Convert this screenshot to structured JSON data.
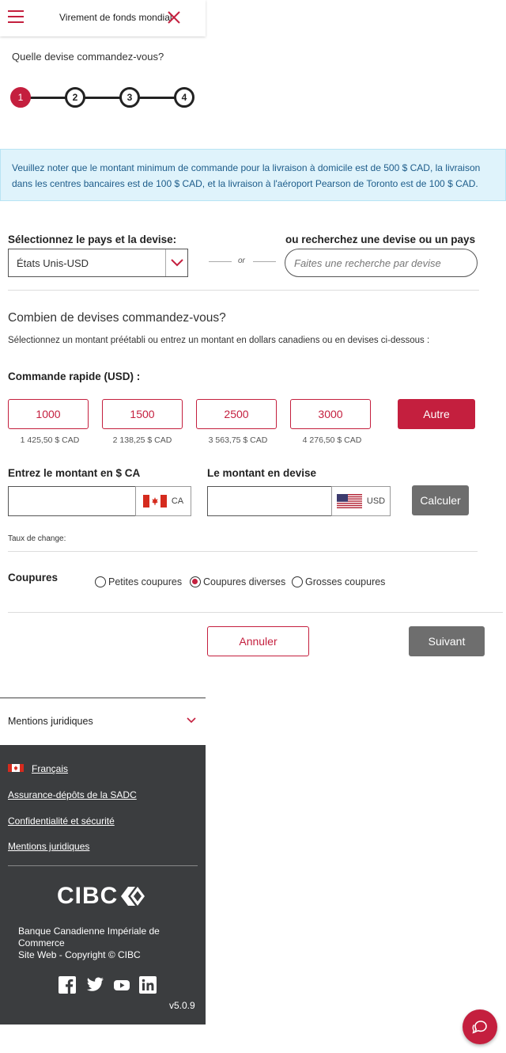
{
  "header": {
    "title": "Virement de fonds mondial"
  },
  "question": "Quelle devise commandez-vous?",
  "stepper": {
    "steps": [
      "1",
      "2",
      "3",
      "4"
    ],
    "current_step": 1
  },
  "notice": "Veuillez noter que le montant minimum de commande pour la livraison à domicile est de 500 $ CAD, la livraison dans les centres bancaires est de 100 $ CAD, et la livraison à l'aéroport Pearson de Toronto est de 100 $ CAD.",
  "country_select": {
    "label": "Sélectionnez le pays et la devise:",
    "value": "États Unis-USD"
  },
  "or_text": "or",
  "search": {
    "label": "ou recherchez une devise ou un pays",
    "placeholder": "Faites une recherche par devise",
    "value": ""
  },
  "amount_section": {
    "title": "Combien de devises commandez-vous?",
    "subtitle": "Sélectionnez un montant préétabli ou entrez un montant en dollars canadiens ou en devises ci-dessous :"
  },
  "quick_order": {
    "label": "Commande rapide (USD) :",
    "options": [
      {
        "amount": "1000",
        "cad": "1 425,50 $ CAD"
      },
      {
        "amount": "1500",
        "cad": "2 138,25 $ CAD"
      },
      {
        "amount": "2500",
        "cad": "3 563,75 $ CAD"
      },
      {
        "amount": "3000",
        "cad": "4 276,50 $ CAD"
      }
    ],
    "other_label": "Autre"
  },
  "cad_input": {
    "label": "Entrez le montant en $ CA",
    "value": "",
    "currency": "CA"
  },
  "fx_input": {
    "label": "Le montant en devise",
    "value": "",
    "currency": "USD"
  },
  "calculate_label": "Calculer",
  "rate_label": "Taux de change:",
  "denominations": {
    "label": "Coupures",
    "options": [
      "Petites coupures",
      "Coupures diverses",
      "Grosses coupures"
    ],
    "selected": "Coupures diverses"
  },
  "actions": {
    "cancel": "Annuler",
    "next": "Suivant"
  },
  "legal_accordion": "Mentions juridiques",
  "footer": {
    "language": "Français",
    "links": [
      "Assurance-dépôts de la SADC",
      "Confidentialité et sécurité",
      "Mentions juridiques"
    ],
    "logo": "CIBC",
    "corp_name": "Banque Canadienne Impériale de Commerce",
    "copyright": "Site Web - Copyright © CIBC",
    "social": [
      "facebook-icon",
      "twitter-icon",
      "youtube-icon",
      "linkedin-icon"
    ],
    "version": "v5.0.9"
  },
  "colors": {
    "brand": "#c41f3e",
    "footer_bg": "#3b3d3f",
    "notice_bg": "#dff3fb",
    "button_gray": "#6e6e6e"
  }
}
